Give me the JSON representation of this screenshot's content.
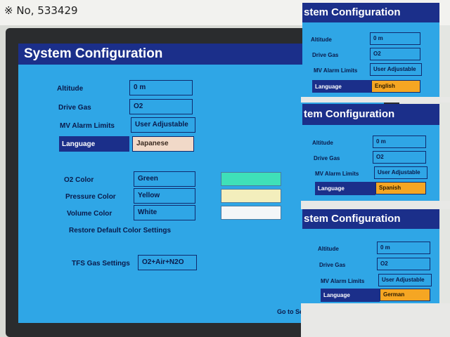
{
  "photo": {
    "lot_label": "※ No, 533429"
  },
  "main": {
    "title": "System Configuration",
    "rows": [
      {
        "label": "Altitude",
        "value": "0 m"
      },
      {
        "label": "Drive Gas",
        "value": "O2"
      },
      {
        "label": "MV Alarm Limits",
        "value": "User Adjustable"
      },
      {
        "label": "Language",
        "value": "Japanese"
      }
    ],
    "colors": [
      {
        "label": "O2 Color",
        "value": "Green",
        "swatch": "#3fe0b8"
      },
      {
        "label": "Pressure Color",
        "value": "Yellow",
        "swatch": "#f3eebc"
      },
      {
        "label": "Volume Color",
        "value": "White",
        "swatch": "#f4f6f8"
      }
    ],
    "restore_label": "Restore Default Color Settings",
    "tfs": {
      "label": "TFS Gas Settings",
      "value": "O2+Air+N2O"
    },
    "service_label": "Go to Service Modes Menu"
  },
  "insets": [
    {
      "title": "stem Configuration",
      "rows": [
        {
          "label": "Altitude",
          "value": "0 m"
        },
        {
          "label": "Drive Gas",
          "value": "O2"
        },
        {
          "label": "MV Alarm Limits",
          "value": "User Adjustable"
        },
        {
          "label": "Language",
          "value": "English"
        }
      ]
    },
    {
      "title": "tem Configuration",
      "rows": [
        {
          "label": "Altitude",
          "value": "0 m"
        },
        {
          "label": "Drive Gas",
          "value": "O2"
        },
        {
          "label": "MV Alarm Limits",
          "value": "User Adjustable"
        },
        {
          "label": "Language",
          "value": "Spanish"
        }
      ]
    },
    {
      "title": "stem Configuration",
      "rows": [
        {
          "label": "Altitude",
          "value": "0 m"
        },
        {
          "label": "Drive Gas",
          "value": "O2"
        },
        {
          "label": "MV Alarm Limits",
          "value": "User Adjustable"
        },
        {
          "label": "Language",
          "value": "German"
        }
      ]
    }
  ],
  "theme": {
    "screen_bg": "#2fa6e6",
    "titlebar_bg": "#1b2f8a",
    "selection_bg": "#1b2f8a",
    "selected_value_bg": "#f5a623",
    "japanese_value_bg": "#f1d9c8"
  }
}
